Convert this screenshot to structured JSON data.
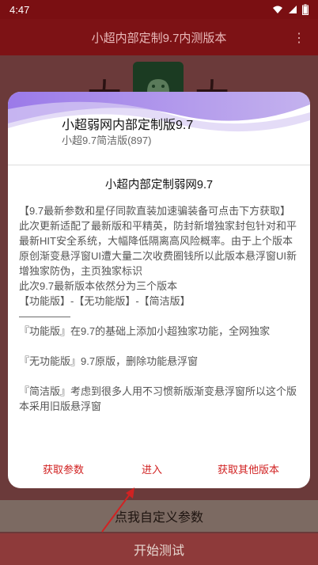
{
  "status_bar": {
    "time": "4:47"
  },
  "app_bar": {
    "title": "小超内部定制9.7内测版本",
    "menu_glyph": "⋮"
  },
  "background": {
    "custom_params_button": "点我自定义参数",
    "start_test_button": "开始测试",
    "left_char": "大",
    "right_char": "大"
  },
  "dialog": {
    "title": "小超弱网内部定制版9.7",
    "subtitle": "小超9.7简洁版(897)",
    "content_title": "小超内部定制弱网9.7",
    "body": [
      "【9.7最新参数和星仔同款直装加速骗装备可点击下方获取】",
      "此次更新适配了最新版和平精英，防封新增独家封包针对和平最新HIT安全系统，大幅降低隔离高风险概率。由于上个版本原创渐变悬浮窗UI遭大量二次收费圈钱所以此版本悬浮窗UI新增独家防伪，主页独家标识",
      "此次9.7最新版本依然分为三个版本",
      "【功能版】-【无功能版】-【简洁版】",
      "—————",
      "『功能版』在9.7的基础上添加小超独家功能，全网独家",
      "",
      "『无功能版』9.7原版，删除功能悬浮窗",
      "",
      "『简洁版』考虑到很多人用不习惯新版渐变悬浮窗所以这个版本采用旧版悬浮窗"
    ],
    "buttons": {
      "get_params": "获取参数",
      "enter": "进入",
      "get_other_versions": "获取其他版本"
    }
  },
  "colors": {
    "accent_red": "#d12222",
    "header_purple": "#8e7ae6",
    "appbar_red": "#7d1215"
  },
  "icons": [
    "wifi-icon",
    "signal-icon",
    "battery-icon",
    "overflow-menu-icon",
    "android-logo-icon",
    "arrow-annotation"
  ]
}
